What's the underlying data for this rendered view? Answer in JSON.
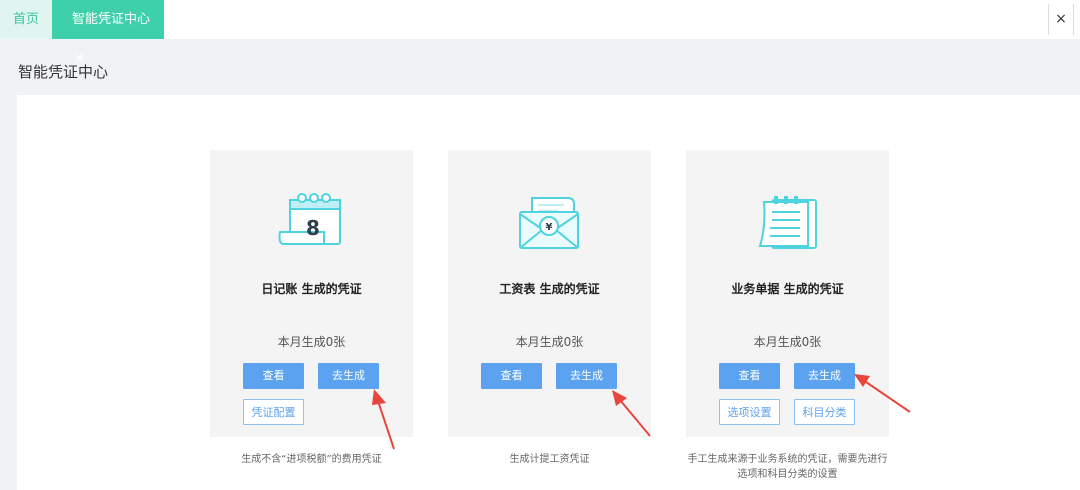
{
  "tabs": {
    "home": "首页",
    "active": "智能凭证中心",
    "active_close": "×",
    "close_all": "×"
  },
  "page": {
    "title": "智能凭证中心"
  },
  "cards": [
    {
      "title": "日记账 生成的凭证",
      "count": "本月生成0张",
      "primary_buttons": [
        "查看",
        "去生成"
      ],
      "secondary_buttons": [
        "凭证配置"
      ],
      "desc": "生成不含“进项税额”的费用凭证",
      "icon": "calendar-icon"
    },
    {
      "title": "工资表 生成的凭证",
      "count": "本月生成0张",
      "primary_buttons": [
        "查看",
        "去生成"
      ],
      "secondary_buttons": [],
      "desc": "生成计提工资凭证",
      "icon": "salary-envelope-icon"
    },
    {
      "title": "业务单据 生成的凭证",
      "count": "本月生成0张",
      "primary_buttons": [
        "查看",
        "去生成"
      ],
      "secondary_buttons": [
        "选项设置",
        "科目分类"
      ],
      "desc_line1": "手工生成来源于业务系统的凭证，需要先进行",
      "desc_line2": "选项和科目分类的设置",
      "icon": "document-icon"
    }
  ],
  "colors": {
    "accent": "#3dd0aa",
    "button": "#5ba3f0",
    "icon": "#4fd3e0",
    "arrow": "#e8453c"
  }
}
